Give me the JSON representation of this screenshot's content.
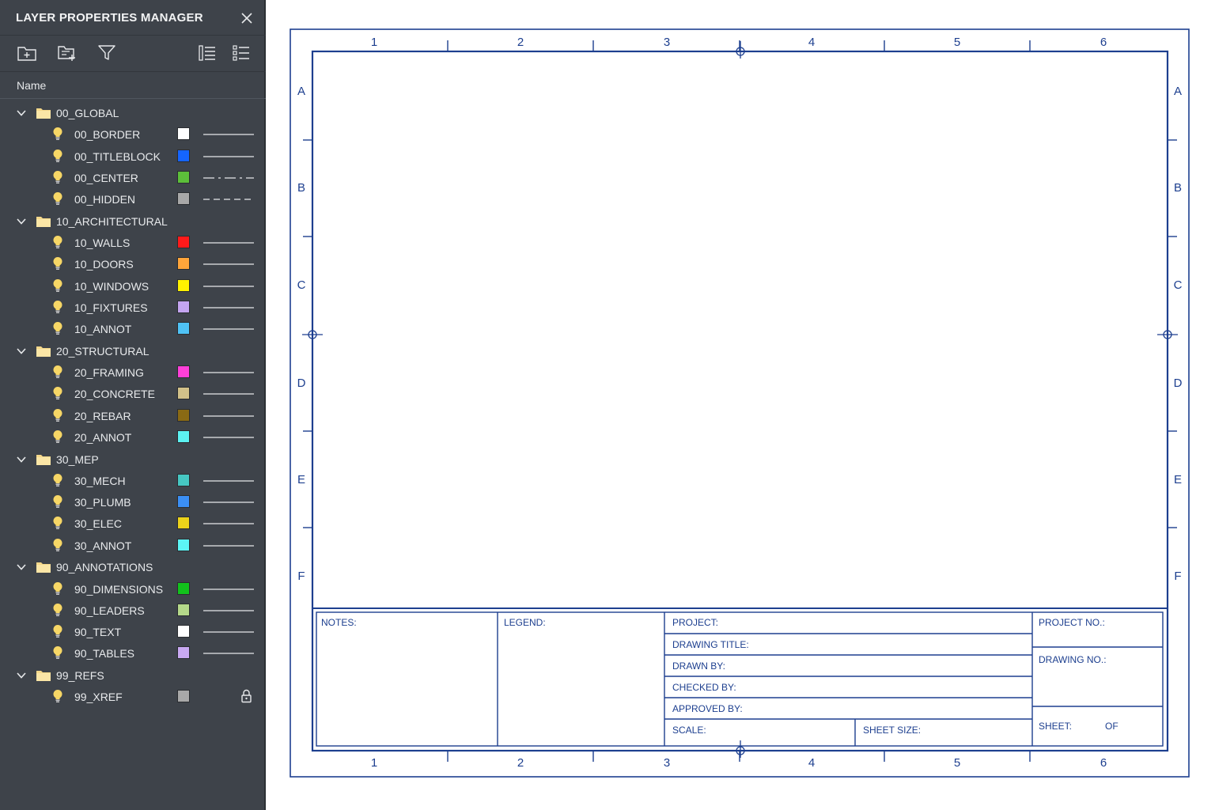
{
  "panel": {
    "title": "LAYER PROPERTIES MANAGER",
    "column_name": "Name",
    "groups": [
      {
        "name": "00_GLOBAL",
        "layers": [
          {
            "name": "00_BORDER",
            "color": "#ffffff",
            "linetype": "continuous"
          },
          {
            "name": "00_TITLEBLOCK",
            "color": "#1565ff",
            "linetype": "continuous"
          },
          {
            "name": "00_CENTER",
            "color": "#5cbf3a",
            "linetype": "center"
          },
          {
            "name": "00_HIDDEN",
            "color": "#a8a8a8",
            "linetype": "hidden"
          }
        ]
      },
      {
        "name": "10_ARCHITECTURAL",
        "layers": [
          {
            "name": "10_WALLS",
            "color": "#ff1a1a",
            "linetype": "continuous"
          },
          {
            "name": "10_DOORS",
            "color": "#ffa53a",
            "linetype": "continuous"
          },
          {
            "name": "10_WINDOWS",
            "color": "#fff200",
            "linetype": "continuous"
          },
          {
            "name": "10_FIXTURES",
            "color": "#c4a5f0",
            "linetype": "continuous"
          },
          {
            "name": "10_ANNOT",
            "color": "#4fc2f5",
            "linetype": "continuous"
          }
        ]
      },
      {
        "name": "20_STRUCTURAL",
        "layers": [
          {
            "name": "20_FRAMING",
            "color": "#ff3fd9",
            "linetype": "continuous"
          },
          {
            "name": "20_CONCRETE",
            "color": "#d2c189",
            "linetype": "continuous"
          },
          {
            "name": "20_REBAR",
            "color": "#8a6a14",
            "linetype": "continuous"
          },
          {
            "name": "20_ANNOT",
            "color": "#5cf2f2",
            "linetype": "continuous"
          }
        ]
      },
      {
        "name": "30_MEP",
        "layers": [
          {
            "name": "30_MECH",
            "color": "#46c7c2",
            "linetype": "continuous"
          },
          {
            "name": "30_PLUMB",
            "color": "#3b8ff5",
            "linetype": "continuous"
          },
          {
            "name": "30_ELEC",
            "color": "#ecd21a",
            "linetype": "continuous"
          },
          {
            "name": "30_ANNOT",
            "color": "#5cf5f5",
            "linetype": "continuous"
          }
        ]
      },
      {
        "name": "90_ANNOTATIONS",
        "layers": [
          {
            "name": "90_DIMENSIONS",
            "color": "#12c21c",
            "linetype": "continuous"
          },
          {
            "name": "90_LEADERS",
            "color": "#b5d98a",
            "linetype": "continuous"
          },
          {
            "name": "90_TEXT",
            "color": "#ffffff",
            "linetype": "continuous"
          },
          {
            "name": "90_TABLES",
            "color": "#c9a9f2",
            "linetype": "continuous"
          }
        ]
      },
      {
        "name": "99_REFS",
        "layers": [
          {
            "name": "99_XREF",
            "color": "#a8a8a8",
            "linetype": "none",
            "locked": true
          }
        ]
      }
    ]
  },
  "sheet": {
    "col_labels": [
      "1",
      "2",
      "3",
      "4",
      "5",
      "6"
    ],
    "row_labels": [
      "A",
      "B",
      "C",
      "D",
      "E",
      "F"
    ],
    "border_color": "#1d3f8f",
    "titleblock": {
      "notes": "NOTES:",
      "legend": "LEGEND:",
      "project": "PROJECT:",
      "drawing_title": "DRAWING TITLE:",
      "drawn_by": "DRAWN BY:",
      "checked_by": "CHECKED BY:",
      "approved_by": "APPROVED BY:",
      "scale": "SCALE:",
      "sheet_size": "SHEET SIZE:",
      "project_no": "PROJECT NO.:",
      "drawing_no": "DRAWING NO.:",
      "sheet": "SHEET:",
      "of": "OF"
    }
  }
}
